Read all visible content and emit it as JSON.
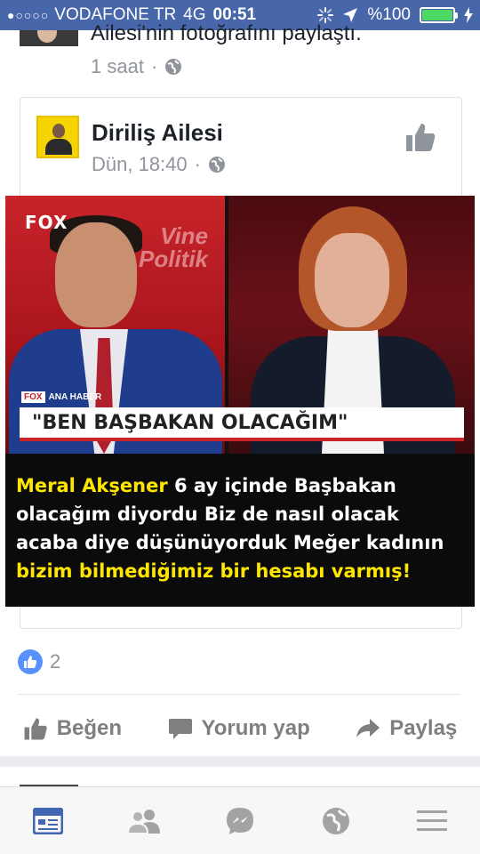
{
  "status_bar": {
    "signal": "●○○○○",
    "carrier": "VODAFONE TR",
    "network": "4G",
    "time": "00:51",
    "battery": "%100",
    "battery_level": 1.0
  },
  "previous_post": {
    "text": "Ailesi'nin fotoğrafını paylaştı.",
    "time": "1 saat"
  },
  "post": {
    "page_name": "Diriliş Ailesi",
    "time": "Dün, 18:40",
    "image": {
      "channel_logo": "FOX",
      "program_logo_line1": "Vine",
      "program_logo_line2": "Politik",
      "news_tag": "FOX",
      "news_tag_label": "ANA HABER",
      "headline": "\"BEN BAŞBAKAN OLACAĞIM\"",
      "caption": {
        "p1_highlight": "Meral Akşener",
        "p1_rest": " 6 ay içinde Başbakan olacağım diyordu Biz de nasıl olacak acaba diye düşünüyorduk Meğer kadının ",
        "p2_highlight": "bizim bilmediğimiz bir hesabı varmış!"
      }
    },
    "like_count": "2"
  },
  "actions": {
    "like": "Beğen",
    "comment": "Yorum yap",
    "share": "Paylaş"
  },
  "tabs": [
    "news-feed",
    "friends",
    "messenger",
    "notifications",
    "menu"
  ],
  "colors": {
    "facebook_blue": "#4867aa",
    "like_blue": "#5890ff",
    "caption_yellow": "#ffe600",
    "fox_red": "#c8242a"
  }
}
